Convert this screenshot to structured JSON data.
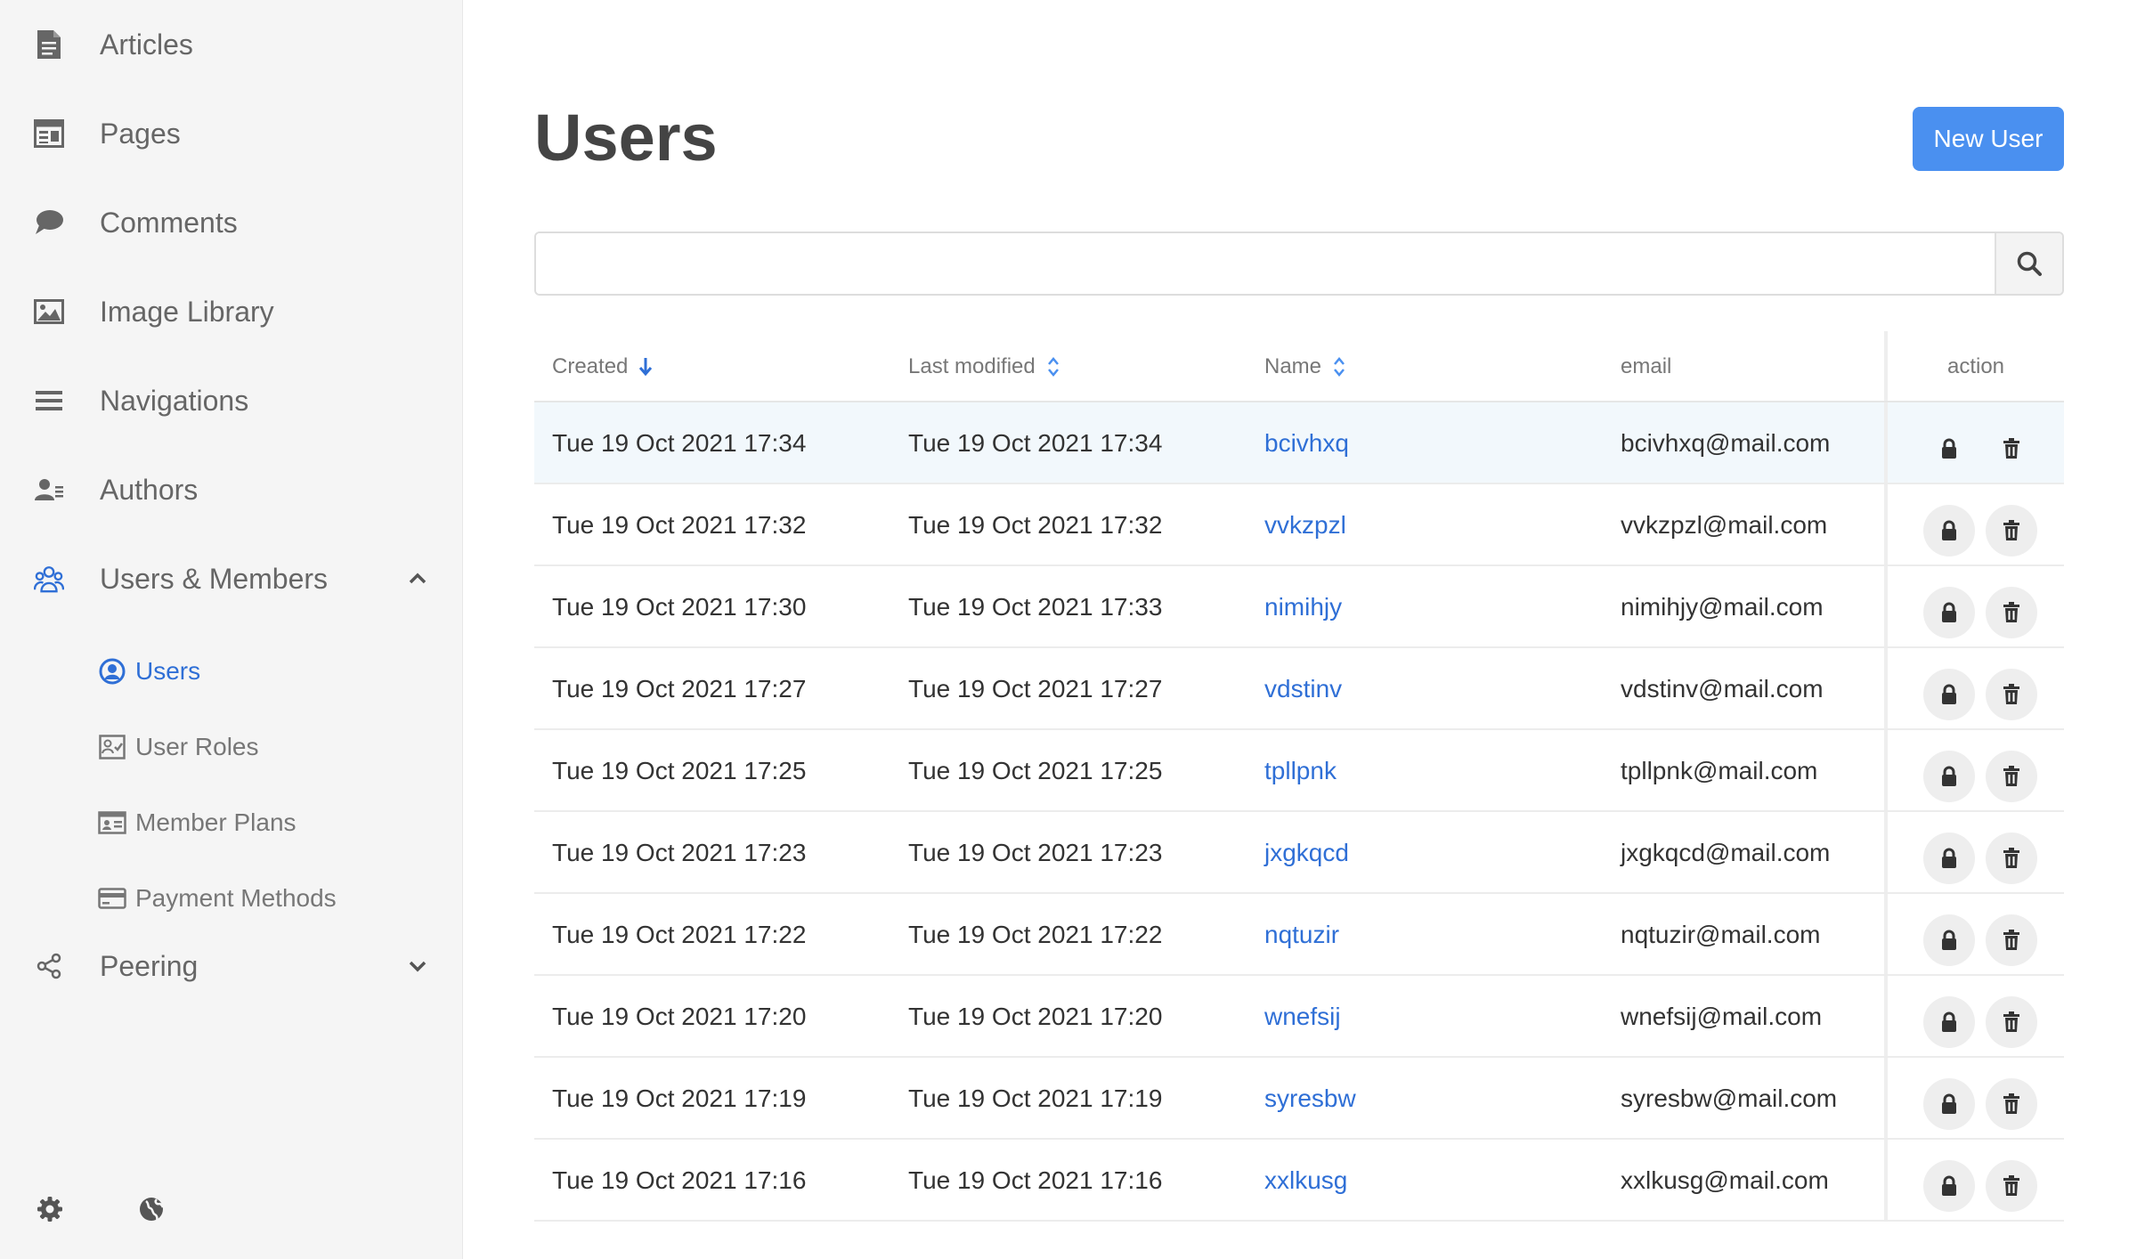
{
  "sidebar": {
    "items": [
      {
        "label": "Articles",
        "icon": "document-icon"
      },
      {
        "label": "Pages",
        "icon": "page-layout-icon"
      },
      {
        "label": "Comments",
        "icon": "speech-bubble-icon"
      },
      {
        "label": "Image Library",
        "icon": "image-icon"
      },
      {
        "label": "Navigations",
        "icon": "hamburger-menu-icon"
      },
      {
        "label": "Authors",
        "icon": "authors-icon"
      },
      {
        "label": "Users & Members",
        "icon": "users-group-icon",
        "expanded": true
      },
      {
        "label": "Peering",
        "icon": "share-icon",
        "expanded": false
      }
    ],
    "subitems": [
      {
        "label": "Users",
        "icon": "user-circle-icon",
        "active": true
      },
      {
        "label": "User Roles",
        "icon": "user-roles-icon",
        "active": false
      },
      {
        "label": "Member Plans",
        "icon": "id-card-icon",
        "active": false
      },
      {
        "label": "Payment Methods",
        "icon": "credit-card-icon",
        "active": false
      }
    ],
    "footer": {
      "settings_icon": "gear-icon",
      "language_icon": "globe-icon"
    }
  },
  "header": {
    "title": "Users",
    "new_button_label": "New User"
  },
  "search": {
    "value": "",
    "placeholder": ""
  },
  "table": {
    "columns": {
      "created": "Created",
      "modified": "Last modified",
      "name": "Name",
      "email": "email",
      "action": "action"
    },
    "sort": {
      "column": "created",
      "direction": "descending"
    },
    "rows": [
      {
        "created": "Tue 19 Oct 2021 17:34",
        "modified": "Tue 19 Oct 2021 17:34",
        "name": "bcivhxq",
        "email": "bcivhxq@mail.com"
      },
      {
        "created": "Tue 19 Oct 2021 17:32",
        "modified": "Tue 19 Oct 2021 17:32",
        "name": "vvkzpzl",
        "email": "vvkzpzl@mail.com"
      },
      {
        "created": "Tue 19 Oct 2021 17:30",
        "modified": "Tue 19 Oct 2021 17:33",
        "name": "nimihjy",
        "email": "nimihjy@mail.com"
      },
      {
        "created": "Tue 19 Oct 2021 17:27",
        "modified": "Tue 19 Oct 2021 17:27",
        "name": "vdstinv",
        "email": "vdstinv@mail.com"
      },
      {
        "created": "Tue 19 Oct 2021 17:25",
        "modified": "Tue 19 Oct 2021 17:25",
        "name": "tpllpnk",
        "email": "tpllpnk@mail.com"
      },
      {
        "created": "Tue 19 Oct 2021 17:23",
        "modified": "Tue 19 Oct 2021 17:23",
        "name": "jxgkqcd",
        "email": "jxgkqcd@mail.com"
      },
      {
        "created": "Tue 19 Oct 2021 17:22",
        "modified": "Tue 19 Oct 2021 17:22",
        "name": "nqtuzir",
        "email": "nqtuzir@mail.com"
      },
      {
        "created": "Tue 19 Oct 2021 17:20",
        "modified": "Tue 19 Oct 2021 17:20",
        "name": "wnefsij",
        "email": "wnefsij@mail.com"
      },
      {
        "created": "Tue 19 Oct 2021 17:19",
        "modified": "Tue 19 Oct 2021 17:19",
        "name": "syresbw",
        "email": "syresbw@mail.com"
      },
      {
        "created": "Tue 19 Oct 2021 17:16",
        "modified": "Tue 19 Oct 2021 17:16",
        "name": "xxlkusg",
        "email": "xxlkusg@mail.com"
      }
    ]
  },
  "colors": {
    "accent": "#4a90f0",
    "link": "#2f6fd6",
    "sidebar_bg": "#f5f5f5",
    "row_highlight": "#f2f8fc"
  }
}
